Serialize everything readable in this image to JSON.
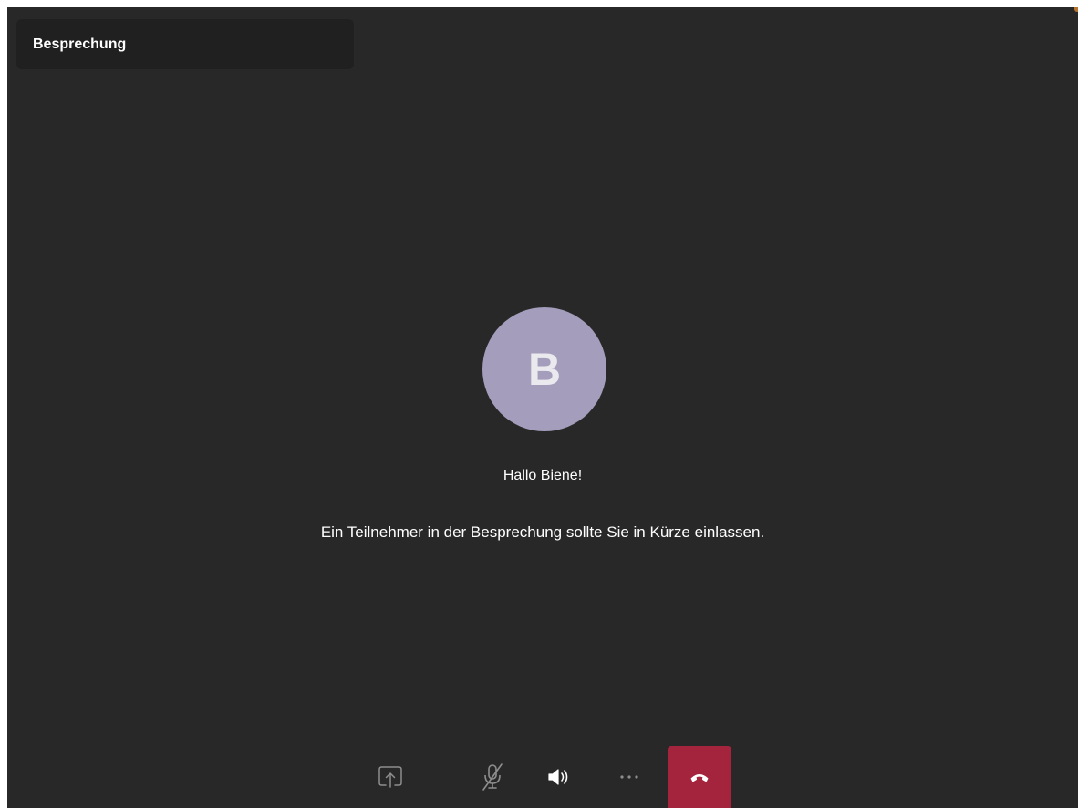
{
  "meeting": {
    "title": "Besprechung"
  },
  "lobby": {
    "avatar_initial": "B",
    "avatar_color": "#a59dbc",
    "greeting": "Hallo Biene!",
    "message": "Ein Teilnehmer in der Besprechung sollte Sie in Kürze einlassen."
  },
  "controls": {
    "share": {
      "icon": "share-screen-icon"
    },
    "microphone": {
      "icon": "mic-off-icon",
      "state": "muted"
    },
    "speaker": {
      "icon": "speaker-icon",
      "state": "on"
    },
    "more": {
      "icon": "more-options-icon"
    },
    "hangup": {
      "icon": "hang-up-icon",
      "color": "#a4243d"
    }
  },
  "theme": {
    "background": "#282828",
    "title_card": "#202020"
  }
}
